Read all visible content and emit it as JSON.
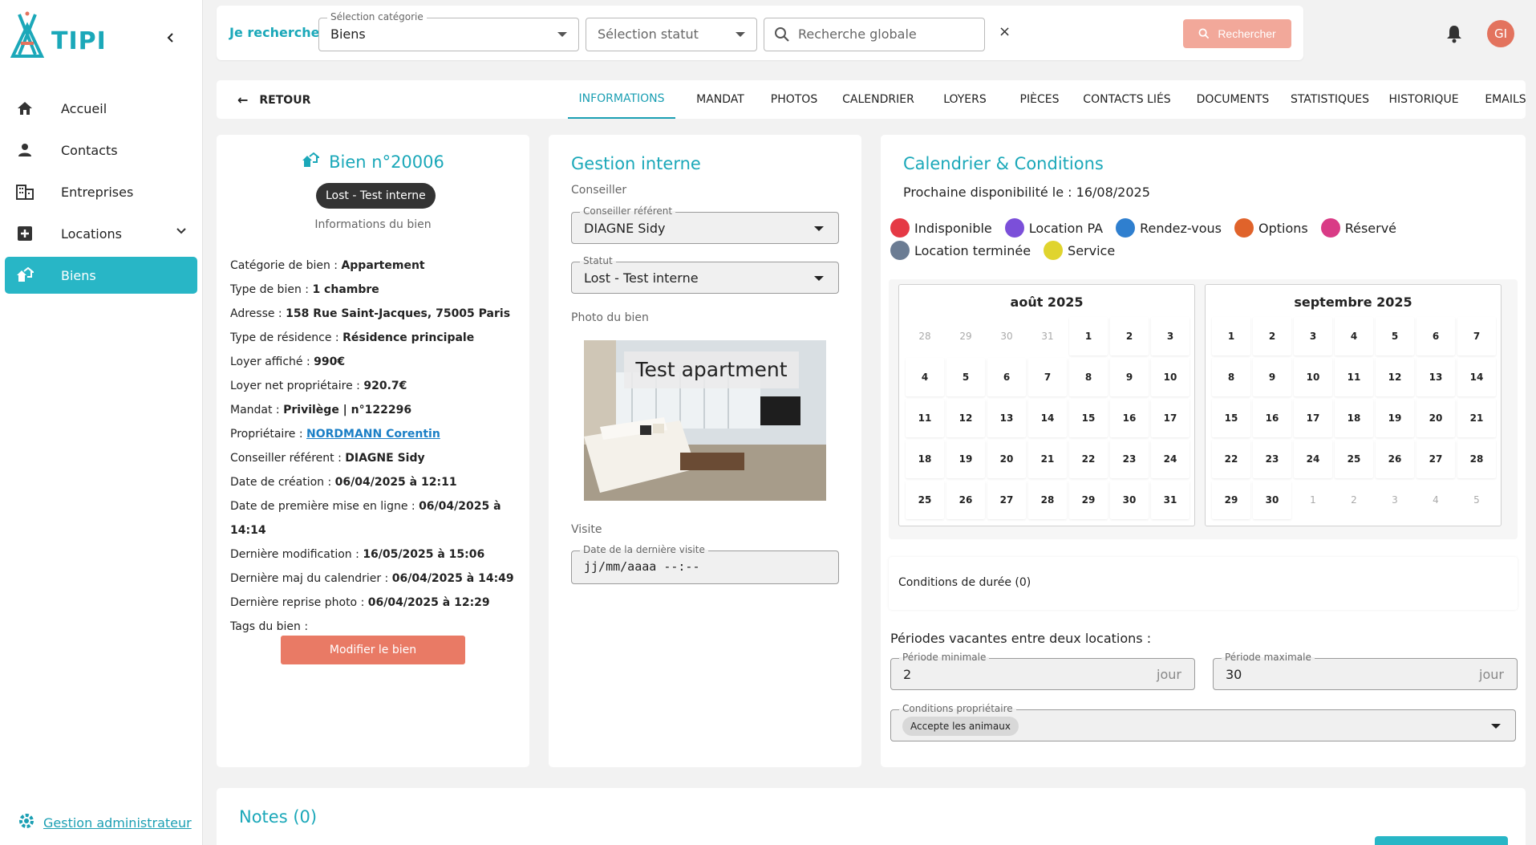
{
  "app": {
    "logo_text": "TIPI"
  },
  "sidebar": {
    "items": [
      {
        "label": "Accueil",
        "icon": "home-icon"
      },
      {
        "label": "Contacts",
        "icon": "person-icon"
      },
      {
        "label": "Entreprises",
        "icon": "building-icon"
      },
      {
        "label": "Locations",
        "icon": "plus-box-icon"
      },
      {
        "label": "Biens",
        "icon": "house-icon",
        "active": true
      }
    ],
    "admin_link": "Gestion administrateur"
  },
  "search": {
    "label": "Je recherche",
    "category_label": "Sélection catégorie",
    "category_value": "Biens",
    "status_placeholder": "Sélection statut",
    "global_placeholder": "Recherche globale",
    "clear": "×",
    "button": "Rechercher"
  },
  "header": {
    "avatar_initials": "GI"
  },
  "tabs": {
    "back": "RETOUR",
    "items": [
      "Informations",
      "Mandat",
      "Photos",
      "Calendrier",
      "Loyers",
      "Pièces",
      "Contacts liés",
      "Documents",
      "Statistiques",
      "Historique",
      "Emails"
    ],
    "active": "Informations"
  },
  "bien": {
    "title": "Bien n°20006",
    "status_chip": "Lost - Test interne",
    "subtitle": "Informations du bien",
    "fields": [
      {
        "label": "Catégorie de bien : ",
        "value": "Appartement"
      },
      {
        "label": "Type de bien : ",
        "value": "1 chambre"
      },
      {
        "label": "Adresse : ",
        "value": "158 Rue Saint-Jacques, 75005 Paris"
      },
      {
        "label": "Type de résidence : ",
        "value": "Résidence principale"
      },
      {
        "label": "Loyer affiché : ",
        "value": "990€"
      },
      {
        "label": "Loyer net propriétaire : ",
        "value": "920.7€"
      },
      {
        "label": "Mandat : ",
        "value": "Privilège | n°122296"
      },
      {
        "label": "Propriétaire : ",
        "value": "NORDMANN Corentin",
        "link": true
      },
      {
        "label": "Conseiller référent : ",
        "value": "DIAGNE Sidy"
      },
      {
        "label": "Date de création : ",
        "value": "06/04/2025 à 12:11"
      },
      {
        "label": "Date de première mise en ligne : ",
        "value": "06/04/2025 à 14:14"
      },
      {
        "label": "Dernière modification : ",
        "value": "16/05/2025 à 15:06"
      },
      {
        "label": "Dernière maj du calendrier : ",
        "value": "06/04/2025 à 14:49"
      },
      {
        "label": "Dernière reprise photo : ",
        "value": "06/04/2025 à 12:29"
      },
      {
        "label": "Tags du bien :",
        "value": ""
      }
    ],
    "edit_button": "Modifier le bien"
  },
  "gestion": {
    "title": "Gestion interne",
    "conseiller_section": "Conseiller",
    "conseiller_label": "Conseiller référent",
    "conseiller_value": "DIAGNE Sidy",
    "statut_label": "Statut",
    "statut_value": "Lost - Test interne",
    "photo_section": "Photo du bien",
    "photo_caption": "Test apartment",
    "visite_section": "Visite",
    "visite_label": "Date de la dernière visite",
    "visite_value": "jj/mm/aaaa --:--"
  },
  "calendar": {
    "title": "Calendrier & Conditions",
    "dispo": "Prochaine disponibilité le : 16/08/2025",
    "legend": [
      {
        "label": "Indisponible",
        "color": "#e53945"
      },
      {
        "label": "Location PA",
        "color": "#7b4fd9"
      },
      {
        "label": "Rendez-vous",
        "color": "#2f7fcf"
      },
      {
        "label": "Options",
        "color": "#e0632b"
      },
      {
        "label": "Réservé",
        "color": "#d93b86"
      },
      {
        "label": "Location terminée",
        "color": "#6b7c93"
      },
      {
        "label": "Service",
        "color": "#e0d42e"
      }
    ],
    "months": [
      {
        "title": "août 2025",
        "days": [
          {
            "d": "28",
            "out": true
          },
          {
            "d": "29",
            "out": true
          },
          {
            "d": "30",
            "out": true
          },
          {
            "d": "31",
            "out": true
          },
          {
            "d": "1"
          },
          {
            "d": "2"
          },
          {
            "d": "3"
          },
          {
            "d": "4"
          },
          {
            "d": "5"
          },
          {
            "d": "6"
          },
          {
            "d": "7"
          },
          {
            "d": "8"
          },
          {
            "d": "9"
          },
          {
            "d": "10"
          },
          {
            "d": "11"
          },
          {
            "d": "12"
          },
          {
            "d": "13"
          },
          {
            "d": "14"
          },
          {
            "d": "15"
          },
          {
            "d": "16"
          },
          {
            "d": "17"
          },
          {
            "d": "18"
          },
          {
            "d": "19"
          },
          {
            "d": "20"
          },
          {
            "d": "21"
          },
          {
            "d": "22"
          },
          {
            "d": "23"
          },
          {
            "d": "24"
          },
          {
            "d": "25"
          },
          {
            "d": "26"
          },
          {
            "d": "27"
          },
          {
            "d": "28"
          },
          {
            "d": "29"
          },
          {
            "d": "30"
          },
          {
            "d": "31"
          }
        ]
      },
      {
        "title": "septembre 2025",
        "days": [
          {
            "d": "1"
          },
          {
            "d": "2"
          },
          {
            "d": "3"
          },
          {
            "d": "4"
          },
          {
            "d": "5"
          },
          {
            "d": "6"
          },
          {
            "d": "7"
          },
          {
            "d": "8"
          },
          {
            "d": "9"
          },
          {
            "d": "10"
          },
          {
            "d": "11"
          },
          {
            "d": "12"
          },
          {
            "d": "13"
          },
          {
            "d": "14"
          },
          {
            "d": "15"
          },
          {
            "d": "16"
          },
          {
            "d": "17"
          },
          {
            "d": "18"
          },
          {
            "d": "19"
          },
          {
            "d": "20"
          },
          {
            "d": "21"
          },
          {
            "d": "22"
          },
          {
            "d": "23"
          },
          {
            "d": "24"
          },
          {
            "d": "25"
          },
          {
            "d": "26"
          },
          {
            "d": "27"
          },
          {
            "d": "28"
          },
          {
            "d": "29"
          },
          {
            "d": "30"
          },
          {
            "d": "1",
            "out": true
          },
          {
            "d": "2",
            "out": true
          },
          {
            "d": "3",
            "out": true
          },
          {
            "d": "4",
            "out": true
          },
          {
            "d": "5",
            "out": true
          }
        ]
      }
    ],
    "conditions_duree": "Conditions de durée (0)",
    "periodes_title": "Périodes vacantes entre deux locations :",
    "periode_min_label": "Période minimale",
    "periode_min_value": "2",
    "periode_max_label": "Période maximale",
    "periode_max_value": "30",
    "unit": "jour",
    "conditions_label": "Conditions propriétaire",
    "conditions_chip": "Accepte les animaux"
  },
  "notes": {
    "title": "Notes (0)"
  }
}
